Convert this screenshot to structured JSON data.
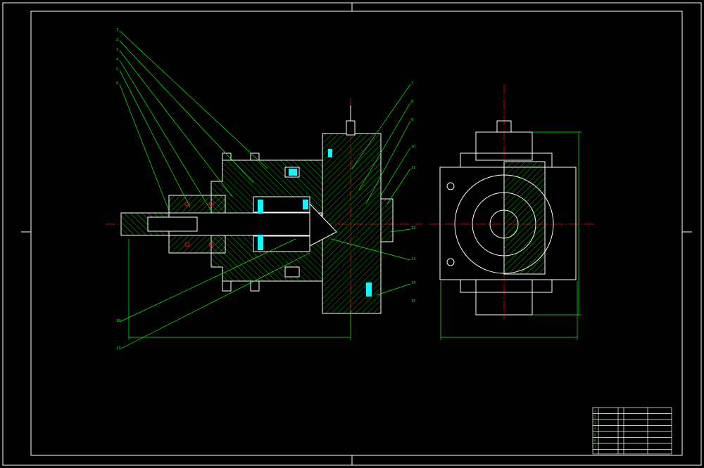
{
  "drawing": {
    "colors": {
      "outline": "#ffffff",
      "geometry": "#ffffff",
      "hatch": "#00ff00",
      "centerline": "#ff0000",
      "dimension": "#00ff00",
      "highlight": "#00ffff",
      "background": "#000000"
    },
    "views": [
      "section-view",
      "end-view"
    ],
    "callouts": {
      "left_group": [
        "1",
        "2",
        "3",
        "4",
        "5",
        "6"
      ],
      "right_group": [
        "7",
        "8",
        "9",
        "10",
        "11",
        "12",
        "13",
        "14",
        "15"
      ],
      "bottom_group": [
        "16",
        "17"
      ]
    },
    "dimensions": {
      "overall_length": "",
      "end_view_width": "",
      "end_view_height": ""
    },
    "notes": {
      "title": "",
      "lines": [
        "",
        "",
        ""
      ]
    },
    "title_block": {
      "rows": [
        [
          "1",
          "",
          "",
          ""
        ],
        [
          "2",
          "",
          "",
          ""
        ],
        [
          "3",
          "",
          "",
          ""
        ],
        [
          "4",
          "",
          "",
          ""
        ],
        [
          "5",
          "",
          "",
          ""
        ],
        [
          "6",
          "",
          "",
          ""
        ],
        [
          "7",
          "",
          "",
          ""
        ]
      ],
      "scale": ""
    }
  }
}
